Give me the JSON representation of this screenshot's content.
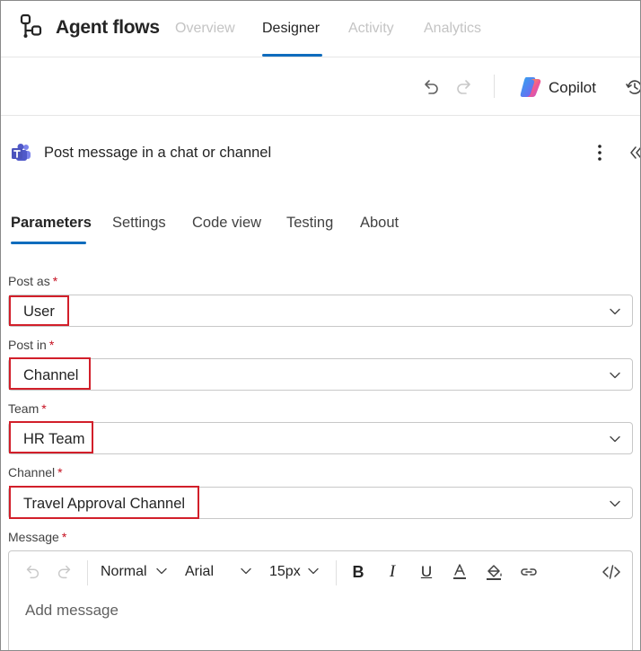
{
  "app": {
    "title": "Agent flows",
    "icon": "flow-icon",
    "nav_tabs": [
      {
        "label": "Overview",
        "active": false
      },
      {
        "label": "Designer",
        "active": true
      },
      {
        "label": "Activity",
        "active": false
      },
      {
        "label": "Analytics",
        "active": false
      }
    ]
  },
  "toolbar": {
    "undo_icon": "undo-icon",
    "redo_icon": "redo-icon",
    "copilot_label": "Copilot",
    "history_icon": "history-icon"
  },
  "action": {
    "title": "Post message in a chat or channel",
    "icon": "teams-icon"
  },
  "tabs": [
    {
      "label": "Parameters",
      "active": true
    },
    {
      "label": "Settings",
      "active": false
    },
    {
      "label": "Code view",
      "active": false
    },
    {
      "label": "Testing",
      "active": false
    },
    {
      "label": "About",
      "active": false
    }
  ],
  "fields": {
    "post_as": {
      "label": "Post as",
      "required_mark": "*",
      "value": "User"
    },
    "post_in": {
      "label": "Post in",
      "required_mark": "*",
      "value": "Channel"
    },
    "team": {
      "label": "Team",
      "required_mark": "*",
      "value": "HR Team"
    },
    "channel": {
      "label": "Channel",
      "required_mark": "*",
      "value": "Travel Approval Channel"
    },
    "message": {
      "label": "Message",
      "required_mark": "*",
      "placeholder": "Add message"
    }
  },
  "editor": {
    "style": "Normal",
    "font": "Arial",
    "size": "15px",
    "bold": "B",
    "italic": "I",
    "underline": "U"
  },
  "colors": {
    "accent": "#0f6cbd",
    "required": "#c50f1f",
    "highlight": "#d21f2a"
  }
}
